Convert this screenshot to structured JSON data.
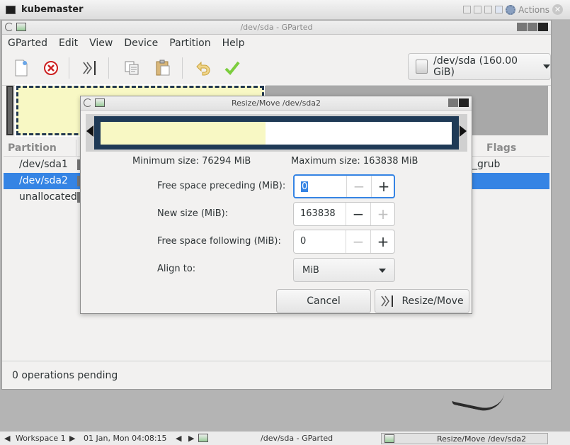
{
  "vnc": {
    "title": "kubemaster",
    "actions_label": "Actions"
  },
  "main_window": {
    "title": "/dev/sda - GParted",
    "menu": [
      "GParted",
      "Edit",
      "View",
      "Device",
      "Partition",
      "Help"
    ],
    "toolbar_icons": [
      "new-icon",
      "delete-icon",
      "resize-move-icon",
      "copy-icon",
      "paste-icon",
      "undo-icon",
      "apply-icon"
    ],
    "device_selector": "/dev/sda (160.00 GiB)",
    "table": {
      "headers": {
        "partition": "Partition",
        "flags": "Flags"
      },
      "rows": [
        {
          "partition": "/dev/sda1",
          "flags": "_grub",
          "selected": false
        },
        {
          "partition": "/dev/sda2",
          "flags": "",
          "selected": true
        },
        {
          "partition": "unallocated",
          "flags": "",
          "selected": false
        }
      ]
    },
    "status": "0 operations pending"
  },
  "dialog": {
    "title": "Resize/Move /dev/sda2",
    "used_fraction": 0.47,
    "minimum_size": "Minimum size: 76294 MiB",
    "maximum_size": "Maximum size: 163838 MiB",
    "fields": [
      {
        "label": "Free space preceding (MiB):",
        "value": "0"
      },
      {
        "label": "New size (MiB):",
        "value": "163838"
      },
      {
        "label": "Free space following (MiB):",
        "value": "0"
      }
    ],
    "align_label": "Align to:",
    "align_value": "MiB",
    "cancel_label": "Cancel",
    "resize_label": "Resize/Move"
  },
  "taskbar": {
    "workspace": "Workspace 1",
    "datetime": "01 Jan, Mon 04:08:15",
    "task1": "/dev/sda - GParted",
    "task2": "Resize/Move /dev/sda2"
  },
  "colors": {
    "selection": "#3584e4",
    "partition_fill": "#f8f8c4",
    "partition_border": "#1f3a56",
    "unallocated": "#a8a8a8"
  }
}
